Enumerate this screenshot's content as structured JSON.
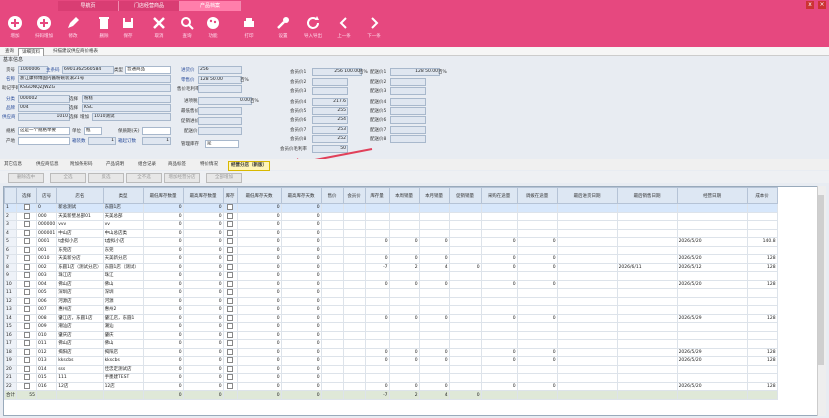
{
  "tabs": [
    "导航页",
    "门店经营商品",
    "产品档案"
  ],
  "active_tab": 2,
  "window_btn": "x",
  "toolbar": [
    {
      "icon": "plus-circle-icon",
      "label": "增加"
    },
    {
      "icon": "plus-circle-icon",
      "label": "扫码增加"
    },
    {
      "icon": "pencil-icon",
      "label": "修改"
    },
    {
      "icon": "trash-icon",
      "label": "删除"
    },
    {
      "icon": "save-icon",
      "label": "保存"
    },
    {
      "icon": "cancel-icon",
      "label": "取消"
    },
    {
      "icon": "search-icon",
      "label": "查询"
    },
    {
      "icon": "palette-icon",
      "label": "功能"
    },
    {
      "icon": "printer-icon",
      "label": "打印"
    },
    {
      "icon": "wrench-icon",
      "label": "设置"
    },
    {
      "icon": "refresh-icon",
      "label": "导入导出"
    },
    {
      "icon": "chevron-left-icon",
      "label": "上一条"
    },
    {
      "icon": "chevron-right-icon",
      "label": "下一条"
    }
  ],
  "subtabs": [
    "查询",
    "详细资料",
    "扫描建议供应商价格表"
  ],
  "active_subtab": 1,
  "basic_title": "基本信息",
  "form": {
    "goods_no_label": "货号",
    "goods_no": "1000006",
    "main_code_label": "主条码",
    "main_code": "6901362560584",
    "type_label": "类型",
    "type": "普通商品",
    "name_label": "名称",
    "name": "浙江康师傅国内酱粉碗装滚21号",
    "help_label": "助记字码",
    "help": "KSGDNQZJWZG",
    "class_label": "分类",
    "class": "000002",
    "class_sel_label": "选择",
    "class_sel": "粉糕",
    "brand_label": "品牌",
    "brand": "004",
    "brand_sel_label": "选择",
    "brand_sel": "KSC",
    "supplier_label": "供应商",
    "supplier": "1010",
    "supplier_sel_label": "选择",
    "supplier_extra_label": "增加",
    "supplier_sel": "1010测试",
    "spec_label": "规格",
    "spec": "这是一个规格举要",
    "unit_label": "单位",
    "unit": "瓶",
    "shelf_label": "保质期(天)",
    "shelf": "",
    "origin_label": "产地",
    "pack_label": "箱装数",
    "pack": "1",
    "shelf_qty_label": "箱起订数",
    "shelf_qty": "1",
    "price_label": "进货价",
    "price": "256",
    "retail_label": "零售价",
    "retail": "128 50.00",
    "retail_unit": "百%",
    "gross_label": "售价毛利率",
    "gross": "",
    "tax_label": "进项税",
    "tax": "0.00",
    "tax_unit": "百%",
    "min_label": "最低售价",
    "min": "",
    "promo_label": "促销进价",
    "promo": "",
    "deliv_label": "配送价",
    "deliv": "",
    "stock_label": "管理库存",
    "stock": "是",
    "m1_label": "会员价1",
    "m1": "256 100.00",
    "m1_unit": "百%",
    "m2_label": "会员价2",
    "m2": "",
    "m3_label": "会员价3",
    "m3": "",
    "m4_label": "会员价4",
    "m4": "217.6",
    "m5_label": "会员价5",
    "m5": "255",
    "m6_label": "会员价6",
    "m6": "254",
    "m7_label": "会员价7",
    "m7": "253",
    "m8_label": "会员价8",
    "m8": "252",
    "mg_label": "会员价毛利率",
    "mg": "50",
    "d1_label": "配送价1",
    "d1": "128 50.00",
    "d1_unit": "百%",
    "d2_label": "配送价2",
    "d2": "",
    "d3_label": "配送价3",
    "d3": "",
    "d4_label": "配送价4",
    "d4": "",
    "d5_label": "配送价5",
    "d5": "",
    "d6_label": "配送价6",
    "d6": "",
    "d7_label": "配送价7",
    "d7": "",
    "d8_label": "配送价8",
    "d8": ""
  },
  "section_tabs": [
    "其它信息",
    "供应商信息",
    "附加条形码",
    "产品说明",
    "组合记录",
    "商品标签",
    "特价情况",
    "经营分店（新版）"
  ],
  "active_section": 7,
  "action_buttons": [
    "删除选中",
    "全选",
    "反选",
    "全不选",
    "增加经营分店",
    "全部增加"
  ],
  "columns": [
    "选择",
    "店号",
    "店名",
    "类型",
    "最低库存数量",
    "最高库存数量",
    "库存",
    "最低库存天数",
    "最高库存天数",
    "售价",
    "会员价",
    "库存量",
    "本周销量",
    "本月销量",
    "促销销量",
    "采购在途量",
    "调拨在途量",
    "最后进货日期",
    "最后销售日期",
    "经营日期",
    "成本价"
  ],
  "rows": [
    {
      "no": "1",
      "sid": "0",
      "name": "新总测试",
      "type": "东圆1店",
      "min": "0",
      "max": "0",
      "d1": "0",
      "d2": "0",
      "stock": "",
      "wk": "",
      "mo": "",
      "promo": "",
      "pin": "",
      "tin": "",
      "lin": "",
      "lsale": "",
      "date": "",
      "cost": "",
      "sel": true
    },
    {
      "no": "2",
      "sid": "000",
      "name": "天美新壁总部01",
      "type": "天美总部",
      "min": "0",
      "max": "0",
      "d1": "0",
      "d2": "0",
      "stock": "",
      "wk": "",
      "mo": "",
      "promo": "",
      "pin": "",
      "tin": "",
      "lin": "",
      "lsale": "",
      "date": "",
      "cost": ""
    },
    {
      "no": "3",
      "sid": "000000",
      "name": "vvv",
      "type": "vv",
      "min": "0",
      "max": "0",
      "d1": "0",
      "d2": "0",
      "stock": "",
      "wk": "",
      "mo": "",
      "promo": "",
      "pin": "",
      "tin": "",
      "lin": "",
      "lsale": "",
      "date": "",
      "cost": ""
    },
    {
      "no": "4",
      "sid": "000001",
      "name": "中山店",
      "type": "中山总店类",
      "min": "0",
      "max": "0",
      "d1": "0",
      "d2": "0",
      "stock": "",
      "wk": "",
      "mo": "",
      "promo": "",
      "pin": "",
      "tin": "",
      "lin": "",
      "lsale": "",
      "date": "",
      "cost": ""
    },
    {
      "no": "5",
      "sid": "0001",
      "name": "t虚拟小店",
      "type": "t虚拟小店",
      "min": "0",
      "max": "0",
      "d1": "0",
      "d2": "0",
      "stock": "0",
      "wk": "0",
      "mo": "0",
      "promo": "",
      "pin": "0",
      "tin": "0",
      "lin": "",
      "lsale": "",
      "date": "2026/5/20",
      "cost": "140.8"
    },
    {
      "no": "6",
      "sid": "001",
      "name": "东莞店",
      "type": "东莞",
      "min": "0",
      "max": "0",
      "d1": "0",
      "d2": "0",
      "stock": "",
      "wk": "",
      "mo": "",
      "promo": "",
      "pin": "",
      "tin": "",
      "lin": "",
      "lsale": "",
      "date": "",
      "cost": ""
    },
    {
      "no": "7",
      "sid": "0010",
      "name": "天美新分店",
      "type": "天美新分店",
      "min": "0",
      "max": "0",
      "d1": "0",
      "d2": "0",
      "stock": "0",
      "wk": "0",
      "mo": "0",
      "promo": "",
      "pin": "0",
      "tin": "0",
      "lin": "",
      "lsale": "",
      "date": "2026/5/20",
      "cost": "128"
    },
    {
      "no": "8",
      "sid": "002",
      "name": "东圆1店（测试分店）",
      "type": "东圆1店（测试）",
      "min": "0",
      "max": "0",
      "d1": "0",
      "d2": "0",
      "stock": "-7",
      "wk": "2",
      "mo": "4",
      "promo": "0",
      "pin": "0",
      "tin": "0",
      "lin": "",
      "lsale": "2026/6/11",
      "date": "2026/5/12",
      "cost": "128"
    },
    {
      "no": "9",
      "sid": "003",
      "name": "珠江店",
      "type": "珠江",
      "min": "0",
      "max": "0",
      "d1": "0",
      "d2": "0",
      "stock": "",
      "wk": "",
      "mo": "",
      "promo": "",
      "pin": "",
      "tin": "",
      "lin": "",
      "lsale": "",
      "date": "",
      "cost": ""
    },
    {
      "no": "10",
      "sid": "004",
      "name": "佛山店",
      "type": "佛山",
      "min": "0",
      "max": "0",
      "d1": "0",
      "d2": "0",
      "stock": "0",
      "wk": "0",
      "mo": "0",
      "promo": "",
      "pin": "0",
      "tin": "0",
      "lin": "",
      "lsale": "",
      "date": "2026/5/20",
      "cost": "128"
    },
    {
      "no": "11",
      "sid": "005",
      "name": "深圳店",
      "type": "深圳",
      "min": "0",
      "max": "0",
      "d1": "0",
      "d2": "0",
      "stock": "",
      "wk": "",
      "mo": "",
      "promo": "",
      "pin": "",
      "tin": "",
      "lin": "",
      "lsale": "",
      "date": "",
      "cost": ""
    },
    {
      "no": "12",
      "sid": "006",
      "name": "河源店",
      "type": "河源",
      "min": "0",
      "max": "0",
      "d1": "0",
      "d2": "0",
      "stock": "",
      "wk": "",
      "mo": "",
      "promo": "",
      "pin": "",
      "tin": "",
      "lin": "",
      "lsale": "",
      "date": "",
      "cost": ""
    },
    {
      "no": "13",
      "sid": "007",
      "name": "惠州店",
      "type": "惠州2",
      "min": "0",
      "max": "0",
      "d1": "0",
      "d2": "0",
      "stock": "",
      "wk": "",
      "mo": "",
      "promo": "",
      "pin": "",
      "tin": "",
      "lin": "",
      "lsale": "",
      "date": "",
      "cost": ""
    },
    {
      "no": "14",
      "sid": "008",
      "name": "肇江店，东圆1店",
      "type": "肇江店，东圆1",
      "min": "0",
      "max": "0",
      "d1": "0",
      "d2": "0",
      "stock": "0",
      "wk": "0",
      "mo": "0",
      "promo": "",
      "pin": "0",
      "tin": "0",
      "lin": "",
      "lsale": "",
      "date": "2026/5/29",
      "cost": "128"
    },
    {
      "no": "15",
      "sid": "009",
      "name": "潮汕店",
      "type": "潮汕",
      "min": "0",
      "max": "0",
      "d1": "0",
      "d2": "0",
      "stock": "",
      "wk": "",
      "mo": "",
      "promo": "",
      "pin": "",
      "tin": "",
      "lin": "",
      "lsale": "",
      "date": "",
      "cost": ""
    },
    {
      "no": "16",
      "sid": "010",
      "name": "肇庆店",
      "type": "肇庆",
      "min": "0",
      "max": "0",
      "d1": "0",
      "d2": "0",
      "stock": "",
      "wk": "",
      "mo": "",
      "promo": "",
      "pin": "",
      "tin": "",
      "lin": "",
      "lsale": "",
      "date": "",
      "cost": ""
    },
    {
      "no": "17",
      "sid": "011",
      "name": "佛山店",
      "type": "佛山",
      "min": "0",
      "max": "0",
      "d1": "0",
      "d2": "0",
      "stock": "",
      "wk": "",
      "mo": "",
      "promo": "",
      "pin": "",
      "tin": "",
      "lin": "",
      "lsale": "",
      "date": "",
      "cost": ""
    },
    {
      "no": "18",
      "sid": "012",
      "name": "揭阳店",
      "type": "揭阳店",
      "min": "0",
      "max": "0",
      "d1": "0",
      "d2": "0",
      "stock": "0",
      "wk": "0",
      "mo": "0",
      "promo": "",
      "pin": "0",
      "tin": "0",
      "lin": "",
      "lsale": "",
      "date": "2026/5/29",
      "cost": "128"
    },
    {
      "no": "19",
      "sid": "013",
      "name": "kkscbs",
      "type": "kkscbs",
      "min": "0",
      "max": "0",
      "d1": "0",
      "d2": "0",
      "stock": "0",
      "wk": "0",
      "mo": "0",
      "promo": "",
      "pin": "0",
      "tin": "0",
      "lin": "",
      "lsale": "",
      "date": "2026/5/20",
      "cost": "128"
    },
    {
      "no": "20",
      "sid": "014",
      "name": "sss",
      "type": "佳忠定测试店",
      "min": "0",
      "max": "0",
      "d1": "0",
      "d2": "0",
      "stock": "",
      "wk": "",
      "mo": "",
      "promo": "",
      "pin": "",
      "tin": "",
      "lin": "",
      "lsale": "",
      "date": "",
      "cost": ""
    },
    {
      "no": "21",
      "sid": "015",
      "name": "111",
      "type": "手墨建TEST",
      "min": "0",
      "max": "0",
      "d1": "0",
      "d2": "0",
      "stock": "",
      "wk": "",
      "mo": "",
      "promo": "",
      "pin": "",
      "tin": "",
      "lin": "",
      "lsale": "",
      "date": "",
      "cost": ""
    },
    {
      "no": "22",
      "sid": "016",
      "name": "12店",
      "type": "12店",
      "min": "0",
      "max": "0",
      "d1": "0",
      "d2": "0",
      "stock": "0",
      "wk": "0",
      "mo": "0",
      "promo": "",
      "pin": "0",
      "tin": "0",
      "lin": "",
      "lsale": "",
      "date": "2026/5/20",
      "cost": "128"
    }
  ],
  "total": {
    "label": "合计",
    "count": "55",
    "min": "0",
    "max": "0",
    "d1": "0",
    "d2": "0",
    "stock": "-7",
    "wk": "2",
    "mo": "4",
    "promo": "0"
  },
  "colors": {
    "accent": "#e6487f",
    "arrow": "#e0405a",
    "header": "#dde7f3"
  }
}
